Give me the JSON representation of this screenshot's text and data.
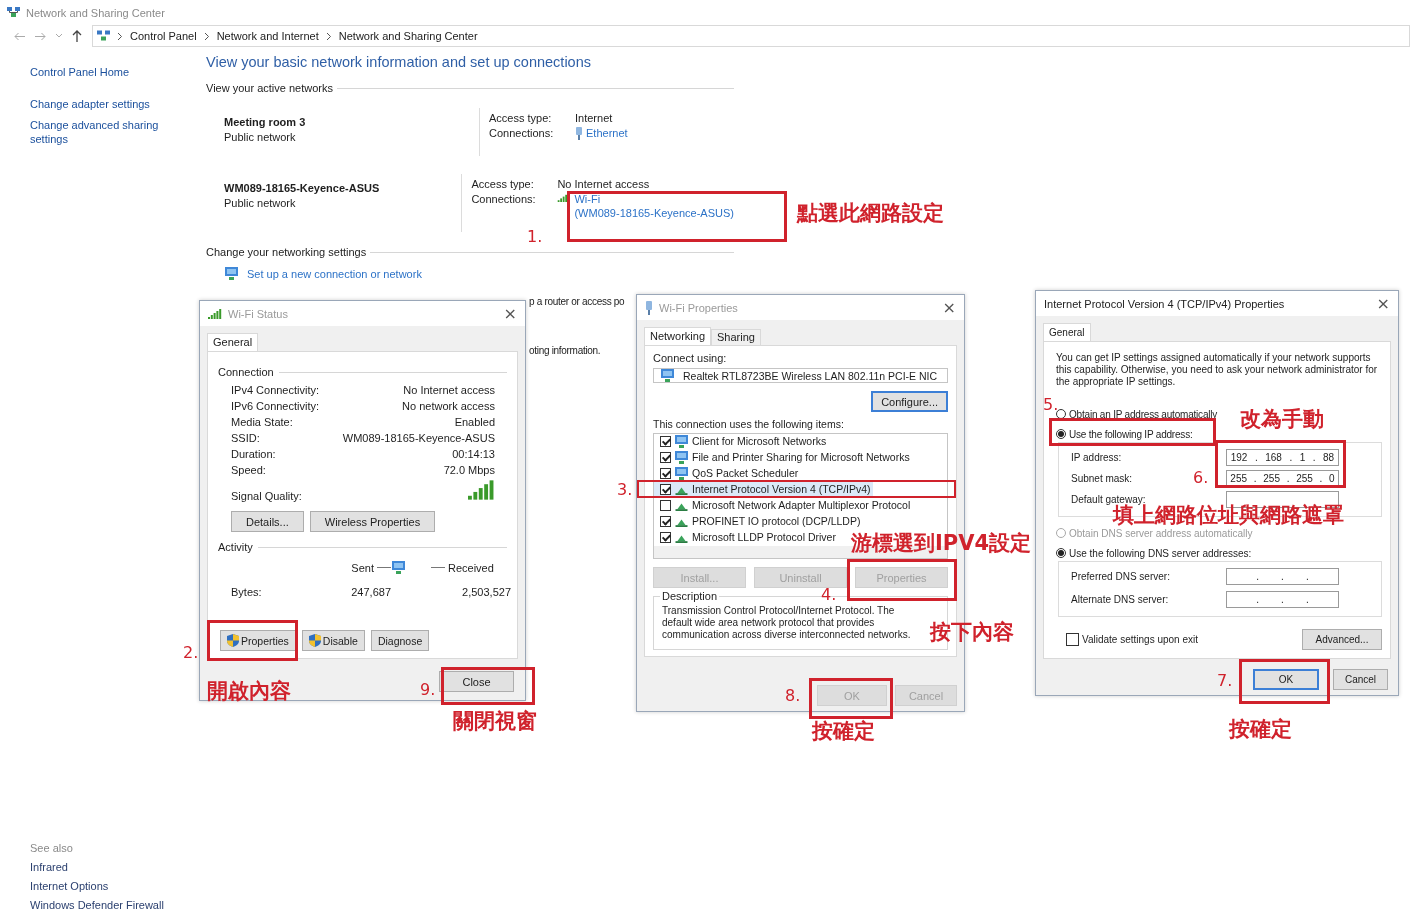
{
  "window": {
    "title": "Network and Sharing Center"
  },
  "breadcrumb": [
    "Control Panel",
    "Network and Internet",
    "Network and Sharing Center"
  ],
  "sidebar": {
    "links": [
      "Control Panel Home",
      "Change adapter settings",
      "Change advanced sharing settings"
    ],
    "see_also_title": "See also",
    "see_also": [
      "Infrared",
      "Internet Options",
      "Windows Defender Firewall"
    ]
  },
  "main": {
    "heading": "View your basic network information and set up connections",
    "active_networks_label": "View your active networks",
    "networks": [
      {
        "name": "Meeting room 3",
        "category": "Public network",
        "access_label": "Access type:",
        "access": "Internet",
        "connections_label": "Connections:",
        "kind": "ethernet",
        "connection": [
          "Ethernet"
        ]
      },
      {
        "name": "WM089-18165-Keyence-ASUS",
        "category": "Public network",
        "access_label": "Access type:",
        "access": "No Internet access",
        "connections_label": "Connections:",
        "kind": "wifi",
        "connection": [
          "Wi-Fi",
          "(WM089-18165-Keyence-ASUS)"
        ]
      }
    ],
    "settings_label": "Change your networking settings",
    "setup_link": "Set up a new connection or network",
    "partial_texts": [
      "p a router or access po",
      "oting information."
    ]
  },
  "wifi_status": {
    "title": "Wi-Fi Status",
    "close_glyph": "×",
    "tabs": [
      {
        "label": "General",
        "selected": true
      }
    ],
    "connection_label": "Connection",
    "rows": [
      {
        "label": "IPv4 Connectivity:",
        "value": "No Internet access"
      },
      {
        "label": "IPv6 Connectivity:",
        "value": "No network access"
      },
      {
        "label": "Media State:",
        "value": "Enabled"
      },
      {
        "label": "SSID:",
        "value": "WM089-18165-Keyence-ASUS"
      },
      {
        "label": "Duration:",
        "value": "00:14:13"
      },
      {
        "label": "Speed:",
        "value": "72.0 Mbps"
      }
    ],
    "signal_label": "Signal Quality:",
    "buttons": [
      "Details...",
      "Wireless Properties"
    ],
    "activity_label": "Activity",
    "sent_label": "Sent",
    "received_label": "Received",
    "bytes_label": "Bytes:",
    "sent": "247,687",
    "received": "2,503,527",
    "actions": [
      {
        "label": "Properties",
        "shield": true
      },
      {
        "label": "Disable",
        "shield": true
      },
      {
        "label": "Diagnose",
        "shield": false
      }
    ],
    "close": "Close"
  },
  "wifi_properties": {
    "title": "Wi-Fi Properties",
    "close_glyph": "×",
    "tabs": [
      {
        "label": "Networking",
        "selected": true
      },
      {
        "label": "Sharing",
        "selected": false
      }
    ],
    "connect_using_label": "Connect using:",
    "adapter": "Realtek RTL8723BE Wireless LAN 802.11n PCI-E NIC",
    "configure": "Configure...",
    "items_label": "This connection uses the following items:",
    "items": [
      {
        "label": "Client for Microsoft Networks",
        "checked": true,
        "selected": false,
        "kind": "client"
      },
      {
        "label": "File and Printer Sharing for Microsoft Networks",
        "checked": true,
        "selected": false,
        "kind": "client"
      },
      {
        "label": "QoS Packet Scheduler",
        "checked": true,
        "selected": false,
        "kind": "client"
      },
      {
        "label": "Internet Protocol Version 4 (TCP/IPv4)",
        "checked": true,
        "selected": true,
        "kind": "protocol"
      },
      {
        "label": "Microsoft Network Adapter Multiplexor Protocol",
        "checked": false,
        "selected": false,
        "kind": "protocol"
      },
      {
        "label": "PROFINET IO protocol (DCP/LLDP)",
        "checked": true,
        "selected": false,
        "kind": "protocol"
      },
      {
        "label": "Microsoft LLDP Protocol Driver",
        "checked": true,
        "selected": false,
        "kind": "protocol"
      }
    ],
    "buttons": [
      {
        "label": "Install...",
        "disabled": true
      },
      {
        "label": "Uninstall",
        "disabled": true
      },
      {
        "label": "Properties",
        "disabled": true
      }
    ],
    "description_label": "Description",
    "description": "Transmission Control Protocol/Internet Protocol. The default wide area network protocol that provides communication across diverse interconnected networks.",
    "footer": [
      {
        "label": "OK",
        "disabled": true
      },
      {
        "label": "Cancel",
        "disabled": true
      }
    ]
  },
  "ipv4": {
    "title": "Internet Protocol Version 4 (TCP/IPv4) Properties",
    "close_glyph": "×",
    "tabs": [
      {
        "label": "General",
        "selected": true
      }
    ],
    "intro": "You can get IP settings assigned automatically if your network supports this capability. Otherwise, you need to ask your network administrator for the appropriate IP settings.",
    "octet_separator": ".",
    "ip_mode": [
      {
        "label": "Obtain an IP address automatically",
        "selected": false,
        "disabled": false
      },
      {
        "label": "Use the following IP address:",
        "selected": true,
        "disabled": false
      }
    ],
    "ip_fields": [
      {
        "label": "IP address:",
        "octets": [
          "192",
          "168",
          "1",
          "88"
        ]
      },
      {
        "label": "Subnet mask:",
        "octets": [
          "255",
          "255",
          "255",
          "0"
        ]
      },
      {
        "label": "Default gateway:"
      }
    ],
    "dns_mode": [
      {
        "label": "Obtain DNS server address automatically",
        "selected": false,
        "disabled": true
      },
      {
        "label": "Use the following DNS server addresses:",
        "selected": true,
        "disabled": false
      }
    ],
    "dns_fields": [
      {
        "label": "Preferred DNS server:"
      },
      {
        "label": "Alternate DNS server:"
      }
    ],
    "validate": {
      "label": "Validate settings upon exit",
      "checked": false
    },
    "advanced": "Advanced...",
    "ok": "OK",
    "cancel": "Cancel"
  },
  "annotations": [
    {
      "number": "1.",
      "caption": "點選此網路設定"
    },
    {
      "number": "5.",
      "caption": "改為手動"
    },
    {
      "number": "3.",
      "caption": "游標選到IPV4設定"
    },
    {
      "number": "6.",
      "caption": "填上網路位址與網路遮罩"
    },
    {
      "number": "2.",
      "caption": "開啟內容"
    },
    {
      "number": "4.",
      "caption": "按下內容"
    },
    {
      "number": "9.",
      "caption": "關閉視窗"
    },
    {
      "number": "8.",
      "caption": "按確定"
    },
    {
      "number": "7.",
      "caption": "按確定"
    }
  ]
}
